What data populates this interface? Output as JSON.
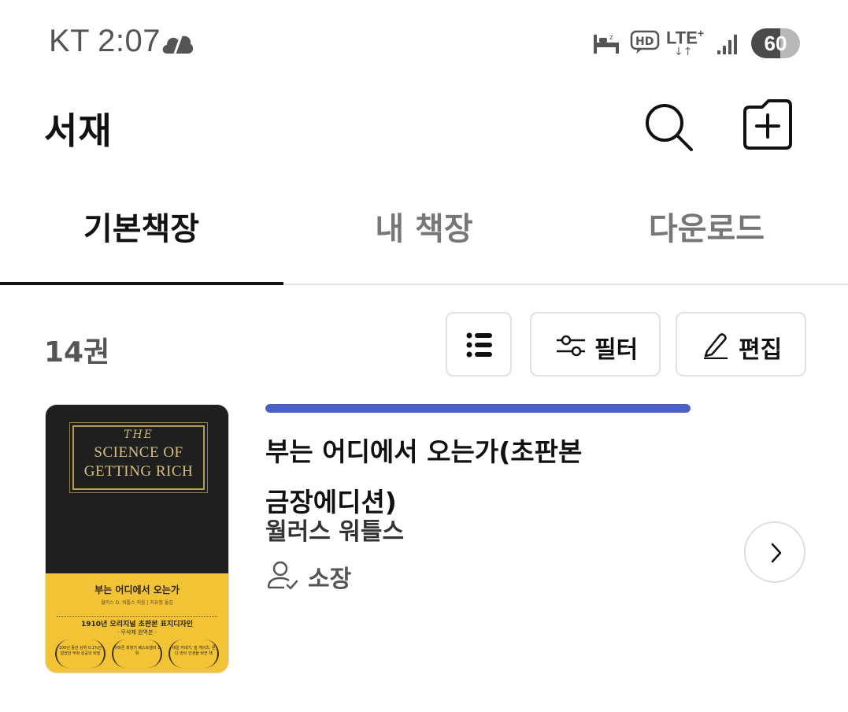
{
  "status_bar": {
    "carrier": "KT",
    "time": "2:07",
    "network": "LTE",
    "network_plus": "+",
    "battery_level": "60",
    "icons": [
      "cloud-icon",
      "sleep-mode-icon",
      "hd-voice-icon",
      "signal-strength-icon",
      "battery-icon"
    ]
  },
  "app_bar": {
    "title": "서재",
    "icons": [
      "search-icon",
      "add-folder-icon"
    ]
  },
  "tabs": [
    {
      "label": "기본책장",
      "active": true
    },
    {
      "label": "내 책장",
      "active": false
    },
    {
      "label": "다운로드",
      "active": false
    }
  ],
  "toolbar": {
    "count_label": "14권",
    "filter_label": "필터",
    "edit_label": "편집",
    "icons": [
      "list-view-icon",
      "filter-sliders-icon",
      "edit-pencil-icon"
    ]
  },
  "books": [
    {
      "title_line1": "부는 어디에서 오는가(초판본",
      "title_line2": "금장에디션)",
      "author": "월러스 워틀스",
      "ownership": "소장",
      "progress": 1.0,
      "progress_color": "#4a60c8",
      "cover": {
        "the": "THE",
        "line1": "SCIENCE OF",
        "line2": "GETTING RICH",
        "kr_title": "부는 어디에서 오는가",
        "kr_author": "월러스 D. 워틀스 지음 | 지유정 옮김",
        "tagline": "1910년 오리지널 초판본 표지디자인",
        "subline": "· 무삭제 완역본 ·",
        "laurel1": "100년 동안 상위 0.1%만 알았던 부와 성공의 비밀",
        "laurel2": "아마존 최장기 베스트셀러 1위",
        "laurel3": "세일 카네기, 빌 게이츠, 론다 번이 인생을 바꾼 책"
      }
    }
  ]
}
